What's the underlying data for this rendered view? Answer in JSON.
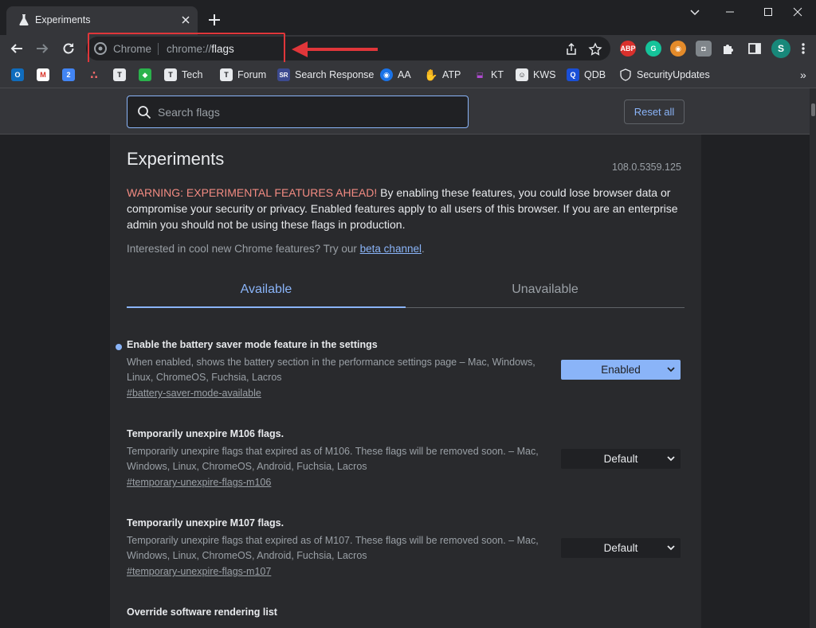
{
  "browser": {
    "tab": {
      "title": "Experiments"
    },
    "omnibox": {
      "chip": "Chrome",
      "url_prefix": "chrome://",
      "url_path": "flags"
    },
    "bookmarks": [
      {
        "label": "",
        "icon": "outlook-icon"
      },
      {
        "label": "",
        "icon": "gmail-icon"
      },
      {
        "label": "",
        "icon": "calendar-icon"
      },
      {
        "label": "",
        "icon": "asana-icon"
      },
      {
        "label": "",
        "icon": "t-icon"
      },
      {
        "label": "",
        "icon": "feedly-icon"
      },
      {
        "label": "Tech",
        "icon": "t-icon"
      },
      {
        "label": "Forum",
        "icon": "t-icon"
      },
      {
        "label": "Search Response",
        "icon": "sr-icon"
      },
      {
        "label": "AA",
        "icon": "eye-icon"
      },
      {
        "label": "ATP",
        "icon": "hand-icon"
      },
      {
        "label": "KT",
        "icon": "kt-icon"
      },
      {
        "label": "KWS",
        "icon": "kws-icon"
      },
      {
        "label": "QDB",
        "icon": "q-icon"
      },
      {
        "label": "SecurityUpdates",
        "icon": "shield-icon"
      }
    ],
    "extensions": {
      "abp": "ABP",
      "profile": "S"
    }
  },
  "flags_page": {
    "search_placeholder": "Search flags",
    "reset_label": "Reset all",
    "heading": "Experiments",
    "version": "108.0.5359.125",
    "warning_label": "WARNING: EXPERIMENTAL FEATURES AHEAD!",
    "warning_text": " By enabling these features, you could lose browser data or compromise your security or privacy. Enabled features apply to all users of this browser. If you are an enterprise admin you should not be using these flags in production.",
    "beta_text": "Interested in cool new Chrome features? Try our ",
    "beta_link": "beta channel",
    "beta_suffix": ".",
    "tabs": {
      "available": "Available",
      "unavailable": "Unavailable"
    },
    "flags": [
      {
        "title": "Enable the battery saver mode feature in the settings",
        "description": "When enabled, shows the battery section in the performance settings page – Mac, Windows, Linux, ChromeOS, Fuchsia, Lacros",
        "link": "#battery-saver-mode-available",
        "value": "Enabled"
      },
      {
        "title": "Temporarily unexpire M106 flags.",
        "description": "Temporarily unexpire flags that expired as of M106. These flags will be removed soon. – Mac, Windows, Linux, ChromeOS, Android, Fuchsia, Lacros",
        "link": "#temporary-unexpire-flags-m106",
        "value": "Default"
      },
      {
        "title": "Temporarily unexpire M107 flags.",
        "description": "Temporarily unexpire flags that expired as of M107. These flags will be removed soon. – Mac, Windows, Linux, ChromeOS, Android, Fuchsia, Lacros",
        "link": "#temporary-unexpire-flags-m107",
        "value": "Default"
      },
      {
        "title": "Override software rendering list",
        "description": "",
        "link": "",
        "value": ""
      }
    ]
  },
  "colors": {
    "accent": "#8ab4f8",
    "warning": "#f28b82",
    "annotation": "#e0363a"
  }
}
